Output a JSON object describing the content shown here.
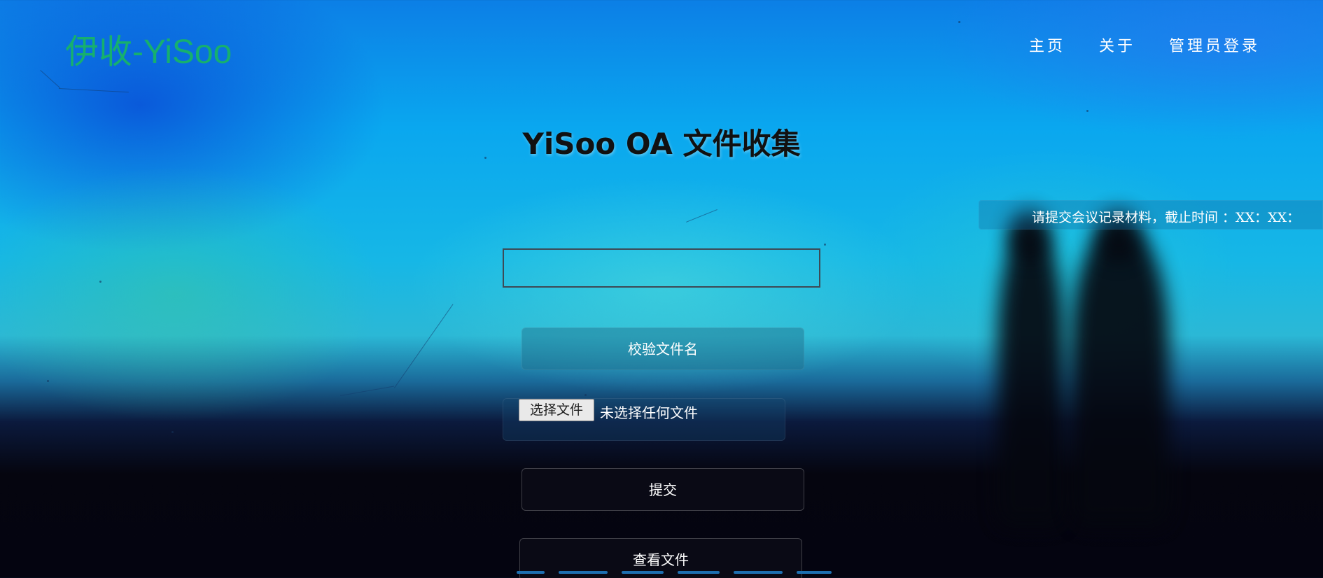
{
  "brand": {
    "logo_text": "伊收-YiSoo"
  },
  "nav": {
    "items": [
      "主页",
      "关于",
      "管理员登录"
    ]
  },
  "main": {
    "title": "YiSoo OA 文件收集",
    "filename_input_value": "",
    "verify_button_label": "校验文件名",
    "file_picker": {
      "choose_label": "选择文件",
      "status_text": "未选择任何文件"
    },
    "submit_button_label": "提交",
    "view_files_button_label": "查看文件"
  },
  "notice": {
    "text": "请提交会议记录材料，截止时间 ：XX：XX："
  },
  "colors": {
    "logo": "#16b06e",
    "title": "#111111",
    "accent_bg": "#0aa7ef"
  }
}
